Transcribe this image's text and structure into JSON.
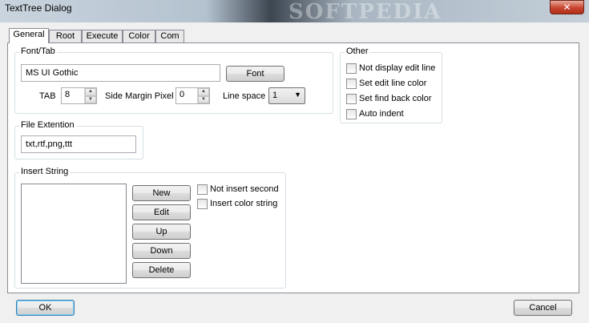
{
  "window": {
    "title": "TextTree Dialog",
    "watermark": "SOFTPEDIA",
    "close_glyph": "✕"
  },
  "tabs": [
    {
      "label": "General",
      "active": true
    },
    {
      "label": "Root",
      "active": false
    },
    {
      "label": "Execute",
      "active": false
    },
    {
      "label": "Color",
      "active": false
    },
    {
      "label": "Com",
      "active": false
    }
  ],
  "font_tab": {
    "legend": "Font/Tab",
    "font_name": "MS UI Gothic",
    "font_button": "Font",
    "tab_label": "TAB",
    "tab_value": "8",
    "side_margin_label": "Side Margin Pixel",
    "side_margin_value": "0",
    "line_space_label": "Line space",
    "line_space_value": "1"
  },
  "file_extension": {
    "legend": "File Extention",
    "value": "txt,rtf,png,ttt"
  },
  "insert_string": {
    "legend": "Insert String",
    "buttons": {
      "new": "New",
      "edit": "Edit",
      "up": "Up",
      "down": "Down",
      "delete": "Delete"
    },
    "options": [
      {
        "label": "Not insert second",
        "checked": false
      },
      {
        "label": "Insert color string",
        "checked": false
      }
    ]
  },
  "other": {
    "legend": "Other",
    "options": [
      {
        "label": "Not display edit line",
        "checked": false
      },
      {
        "label": "Set edit line color",
        "checked": false
      },
      {
        "label": "Set find back color",
        "checked": false
      },
      {
        "label": "Auto indent",
        "checked": false
      }
    ]
  },
  "footer": {
    "ok": "OK",
    "cancel": "Cancel"
  },
  "icons": {
    "spin_up": "▲",
    "spin_down": "▼",
    "dropdown": "▼"
  }
}
